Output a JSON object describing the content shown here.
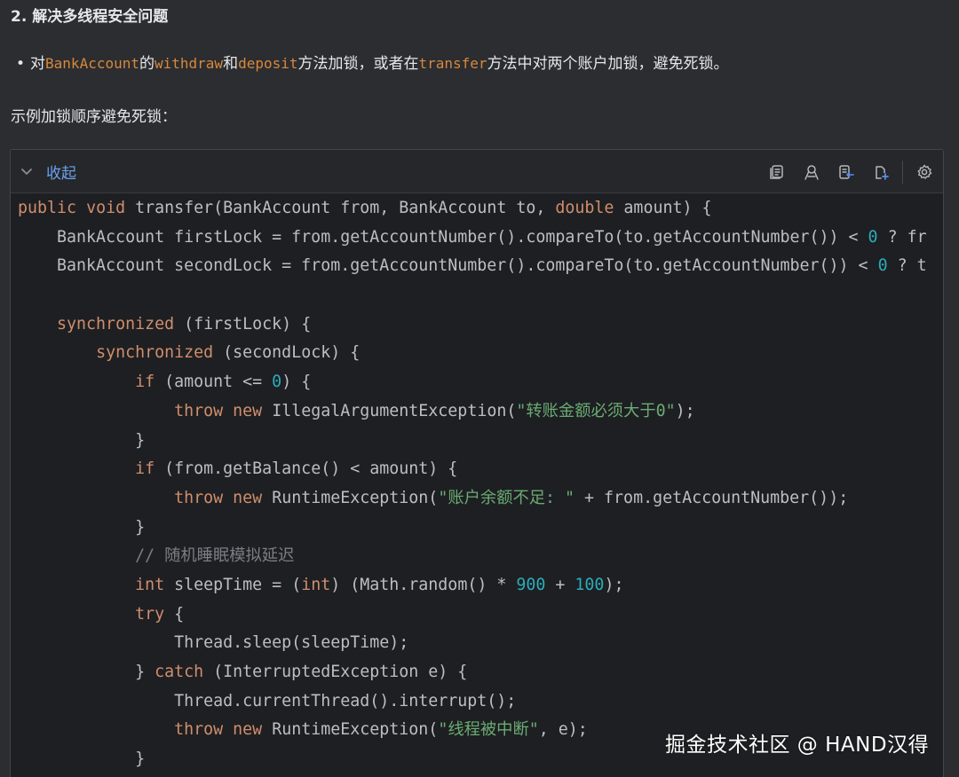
{
  "section_heading": "2. 解决多线程安全问题",
  "bullet": {
    "dot": "•",
    "parts": [
      {
        "text": "对",
        "code": false
      },
      {
        "text": "BankAccount",
        "code": true
      },
      {
        "text": "的",
        "code": false
      },
      {
        "text": "withdraw",
        "code": true
      },
      {
        "text": "和",
        "code": false
      },
      {
        "text": "deposit",
        "code": true
      },
      {
        "text": "方法加锁，或者在",
        "code": false
      },
      {
        "text": "transfer",
        "code": true
      },
      {
        "text": "方法中对两个账户加锁，避免死锁。",
        "code": false
      }
    ]
  },
  "intro_text": "示例加锁顺序避免死锁：",
  "code_block": {
    "collapse_label": "收起",
    "toolbar_icons": [
      "copy-icon",
      "font-icon",
      "insert-icon",
      "paste-new-file-icon",
      "settings-icon"
    ],
    "lines": [
      [
        {
          "t": "public",
          "c": "kw"
        },
        {
          "t": " "
        },
        {
          "t": "void",
          "c": "kw"
        },
        {
          "t": " transfer(BankAccount from, BankAccount to, "
        },
        {
          "t": "double",
          "c": "kw"
        },
        {
          "t": " amount) {"
        }
      ],
      [
        {
          "t": "    BankAccount firstLock = from.getAccountNumber().compareTo(to.getAccountNumber()) < "
        },
        {
          "t": "0",
          "c": "num"
        },
        {
          "t": " ? fr"
        }
      ],
      [
        {
          "t": "    BankAccount secondLock = from.getAccountNumber().compareTo(to.getAccountNumber()) < "
        },
        {
          "t": "0",
          "c": "num"
        },
        {
          "t": " ? t"
        }
      ],
      [
        {
          "t": ""
        }
      ],
      [
        {
          "t": "    "
        },
        {
          "t": "synchronized",
          "c": "kw"
        },
        {
          "t": " (firstLock) {"
        }
      ],
      [
        {
          "t": "        "
        },
        {
          "t": "synchronized",
          "c": "kw"
        },
        {
          "t": " (secondLock) {"
        }
      ],
      [
        {
          "t": "            "
        },
        {
          "t": "if",
          "c": "kw"
        },
        {
          "t": " (amount <= "
        },
        {
          "t": "0",
          "c": "num"
        },
        {
          "t": ") {"
        }
      ],
      [
        {
          "t": "                "
        },
        {
          "t": "throw",
          "c": "kw"
        },
        {
          "t": " "
        },
        {
          "t": "new",
          "c": "kw"
        },
        {
          "t": " IllegalArgumentException("
        },
        {
          "t": "\"转账金额必须大于0\"",
          "c": "str"
        },
        {
          "t": ");"
        }
      ],
      [
        {
          "t": "            }"
        }
      ],
      [
        {
          "t": "            "
        },
        {
          "t": "if",
          "c": "kw"
        },
        {
          "t": " (from.getBalance() < amount) {"
        }
      ],
      [
        {
          "t": "                "
        },
        {
          "t": "throw",
          "c": "kw"
        },
        {
          "t": " "
        },
        {
          "t": "new",
          "c": "kw"
        },
        {
          "t": " RuntimeException("
        },
        {
          "t": "\"账户余额不足: \"",
          "c": "str"
        },
        {
          "t": " + from.getAccountNumber());"
        }
      ],
      [
        {
          "t": "            }"
        }
      ],
      [
        {
          "t": "            "
        },
        {
          "t": "// 随机睡眠模拟延迟",
          "c": "cmt"
        }
      ],
      [
        {
          "t": "            "
        },
        {
          "t": "int",
          "c": "kw"
        },
        {
          "t": " sleepTime = ("
        },
        {
          "t": "int",
          "c": "kw"
        },
        {
          "t": ") (Math.random() * "
        },
        {
          "t": "900",
          "c": "num"
        },
        {
          "t": " + "
        },
        {
          "t": "100",
          "c": "num"
        },
        {
          "t": ");"
        }
      ],
      [
        {
          "t": "            "
        },
        {
          "t": "try",
          "c": "kw"
        },
        {
          "t": " {"
        }
      ],
      [
        {
          "t": "                Thread.sleep(sleepTime);"
        }
      ],
      [
        {
          "t": "            } "
        },
        {
          "t": "catch",
          "c": "kw"
        },
        {
          "t": " (InterruptedException e) {"
        }
      ],
      [
        {
          "t": "                Thread.currentThread().interrupt();"
        }
      ],
      [
        {
          "t": "                "
        },
        {
          "t": "throw",
          "c": "kw"
        },
        {
          "t": " "
        },
        {
          "t": "new",
          "c": "kw"
        },
        {
          "t": " RuntimeException("
        },
        {
          "t": "\"线程被中断\"",
          "c": "str"
        },
        {
          "t": ", e);"
        }
      ],
      [
        {
          "t": "            }"
        }
      ]
    ]
  },
  "watermark": "掘金技术社区 @ HAND汉得",
  "colors": {
    "background": "#2b2d30",
    "code_background": "#1e1f22",
    "keyword": "#cf8e6d",
    "number": "#2aacb8",
    "string": "#6aab73",
    "comment": "#7a7e85",
    "inline_code": "#d7883d",
    "link_blue": "#6ea0f0"
  }
}
